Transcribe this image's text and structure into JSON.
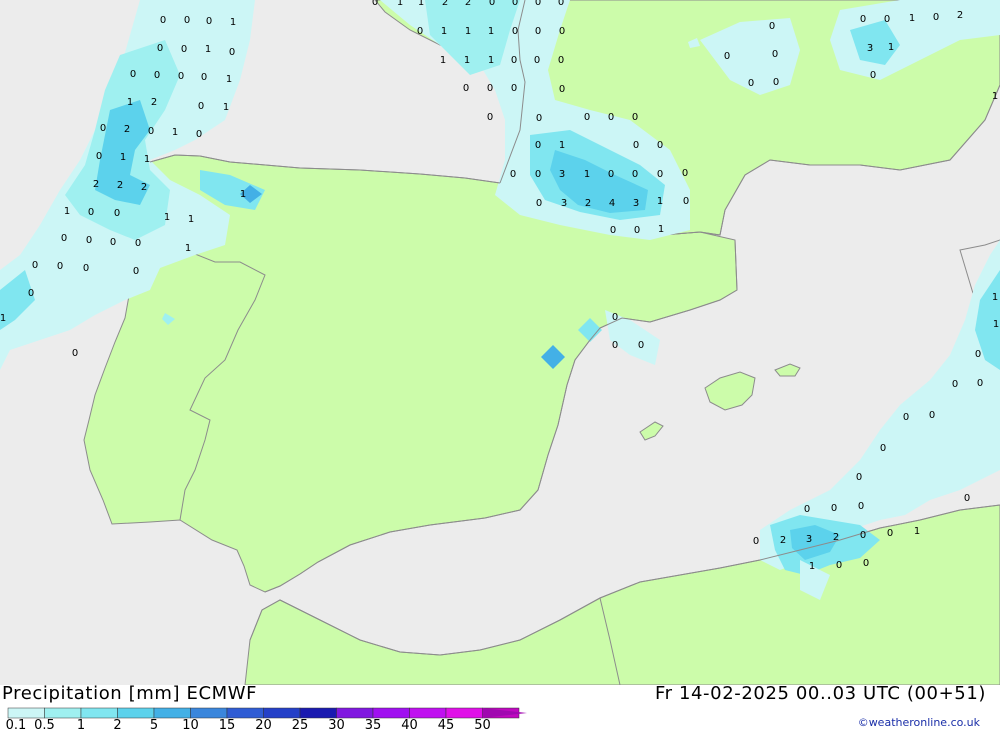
{
  "header": {
    "title": "Precipitation [mm] ECMWF",
    "datetime": "Fr 14-02-2025 00..03 UTC (00+51)",
    "credit": "©weatheronline.co.uk"
  },
  "legend": {
    "labels": [
      "0.1",
      "0.5",
      "1",
      "2",
      "5",
      "10",
      "15",
      "20",
      "25",
      "30",
      "35",
      "40",
      "45",
      "50"
    ],
    "colors": [
      "#ccf6f6",
      "#9ff0f0",
      "#80e6f0",
      "#5cd2ec",
      "#43b0e6",
      "#3a86dc",
      "#2f5cd4",
      "#2440c8",
      "#1a1ab0",
      "#8018e0",
      "#a010f0",
      "#c010f0",
      "#e010e8",
      "#c008c0"
    ]
  },
  "map": {
    "colors": {
      "sea": "#ececec",
      "land": "#ccfcaa",
      "border": "#8c8c8c"
    },
    "values": [
      [
        "0",
        163,
        19
      ],
      [
        "0",
        187,
        19
      ],
      [
        "0",
        209,
        20
      ],
      [
        "1",
        233,
        21
      ],
      [
        "0",
        160,
        47
      ],
      [
        "0",
        184,
        48
      ],
      [
        "1",
        208,
        48
      ],
      [
        "0",
        232,
        51
      ],
      [
        "0",
        133,
        73
      ],
      [
        "0",
        157,
        74
      ],
      [
        "0",
        181,
        75
      ],
      [
        "0",
        204,
        76
      ],
      [
        "1",
        229,
        78
      ],
      [
        "1",
        130,
        101
      ],
      [
        "2",
        154,
        101
      ],
      [
        "0",
        201,
        105
      ],
      [
        "1",
        226,
        106
      ],
      [
        "0",
        103,
        127
      ],
      [
        "2",
        127,
        128
      ],
      [
        "0",
        151,
        130
      ],
      [
        "1",
        175,
        131
      ],
      [
        "0",
        199,
        133
      ],
      [
        "0",
        99,
        155
      ],
      [
        "1",
        123,
        156
      ],
      [
        "1",
        147,
        158
      ],
      [
        "2",
        96,
        183
      ],
      [
        "2",
        120,
        184
      ],
      [
        "2",
        144,
        186
      ],
      [
        "1",
        67,
        210
      ],
      [
        "0",
        91,
        211
      ],
      [
        "0",
        117,
        212
      ],
      [
        "1",
        167,
        216
      ],
      [
        "1",
        191,
        218
      ],
      [
        "0",
        64,
        237
      ],
      [
        "0",
        89,
        239
      ],
      [
        "0",
        113,
        241
      ],
      [
        "0",
        138,
        242
      ],
      [
        "1",
        188,
        247
      ],
      [
        "0",
        35,
        264
      ],
      [
        "0",
        60,
        265
      ],
      [
        "0",
        86,
        267
      ],
      [
        "0",
        136,
        270
      ],
      [
        "0",
        31,
        292
      ],
      [
        "1",
        3,
        317
      ],
      [
        "0",
        75,
        352
      ],
      [
        "1",
        243,
        193
      ],
      [
        "0",
        375,
        1
      ],
      [
        "1",
        400,
        1
      ],
      [
        "1",
        421,
        1
      ],
      [
        "2",
        445,
        1
      ],
      [
        "2",
        468,
        1
      ],
      [
        "0",
        492,
        1
      ],
      [
        "0",
        515,
        1
      ],
      [
        "0",
        538,
        1
      ],
      [
        "0",
        561,
        1
      ],
      [
        "0",
        420,
        30
      ],
      [
        "1",
        444,
        30
      ],
      [
        "1",
        468,
        30
      ],
      [
        "1",
        491,
        30
      ],
      [
        "0",
        515,
        30
      ],
      [
        "0",
        538,
        30
      ],
      [
        "0",
        562,
        30
      ],
      [
        "1",
        443,
        59
      ],
      [
        "1",
        467,
        59
      ],
      [
        "1",
        491,
        59
      ],
      [
        "0",
        514,
        59
      ],
      [
        "0",
        537,
        59
      ],
      [
        "0",
        561,
        59
      ],
      [
        "0",
        466,
        87
      ],
      [
        "0",
        490,
        87
      ],
      [
        "0",
        514,
        87
      ],
      [
        "0",
        562,
        88
      ],
      [
        "0",
        490,
        116
      ],
      [
        "0",
        539,
        117
      ],
      [
        "0",
        587,
        116
      ],
      [
        "0",
        611,
        116
      ],
      [
        "0",
        635,
        116
      ],
      [
        "0",
        538,
        144
      ],
      [
        "1",
        562,
        144
      ],
      [
        "0",
        636,
        144
      ],
      [
        "0",
        660,
        144
      ],
      [
        "0",
        513,
        173
      ],
      [
        "0",
        538,
        173
      ],
      [
        "3",
        562,
        173
      ],
      [
        "1",
        587,
        173
      ],
      [
        "0",
        611,
        173
      ],
      [
        "0",
        635,
        173
      ],
      [
        "0",
        660,
        173
      ],
      [
        "0",
        685,
        172
      ],
      [
        "0",
        539,
        202
      ],
      [
        "3",
        564,
        202
      ],
      [
        "2",
        588,
        202
      ],
      [
        "4",
        612,
        202
      ],
      [
        "3",
        636,
        202
      ],
      [
        "1",
        660,
        200
      ],
      [
        "0",
        686,
        200
      ],
      [
        "0",
        613,
        229
      ],
      [
        "0",
        637,
        229
      ],
      [
        "1",
        661,
        228
      ],
      [
        "0",
        772,
        25
      ],
      [
        "0",
        727,
        55
      ],
      [
        "0",
        775,
        53
      ],
      [
        "0",
        751,
        82
      ],
      [
        "0",
        776,
        81
      ],
      [
        "0",
        863,
        18
      ],
      [
        "0",
        887,
        18
      ],
      [
        "1",
        912,
        17
      ],
      [
        "0",
        936,
        16
      ],
      [
        "2",
        960,
        14
      ],
      [
        "3",
        870,
        47
      ],
      [
        "1",
        891,
        46
      ],
      [
        "0",
        873,
        74
      ],
      [
        "1",
        995,
        95
      ],
      [
        "0",
        615,
        316
      ],
      [
        "0",
        615,
        344
      ],
      [
        "0",
        641,
        344
      ],
      [
        "1",
        995,
        296
      ],
      [
        "1",
        996,
        323
      ],
      [
        "0",
        978,
        353
      ],
      [
        "0",
        955,
        383
      ],
      [
        "0",
        980,
        382
      ],
      [
        "0",
        906,
        416
      ],
      [
        "0",
        932,
        414
      ],
      [
        "0",
        883,
        447
      ],
      [
        "0",
        859,
        476
      ],
      [
        "0",
        967,
        497
      ],
      [
        "0",
        807,
        508
      ],
      [
        "0",
        834,
        507
      ],
      [
        "0",
        861,
        505
      ],
      [
        "0",
        756,
        540
      ],
      [
        "2",
        783,
        539
      ],
      [
        "3",
        809,
        538
      ],
      [
        "2",
        836,
        536
      ],
      [
        "0",
        863,
        534
      ],
      [
        "0",
        890,
        532
      ],
      [
        "1",
        917,
        530
      ],
      [
        "1",
        812,
        565
      ],
      [
        "0",
        839,
        564
      ],
      [
        "0",
        866,
        562
      ]
    ]
  }
}
